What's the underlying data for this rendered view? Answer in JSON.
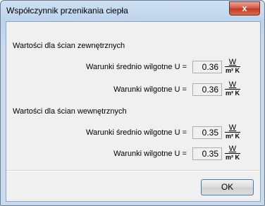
{
  "window": {
    "title": "Współczynnik przenikania ciepła",
    "close_glyph": "x"
  },
  "groups": [
    {
      "header": "Wartości dla ścian zewnętrznych",
      "rows": [
        {
          "label": "Warunki średnio wilgotne U =",
          "value": "0.36",
          "unit_num": "W",
          "unit_den": "m² K"
        },
        {
          "label": "Warunki wilgotne U =",
          "value": "0.36",
          "unit_num": "W",
          "unit_den": "m² K"
        }
      ]
    },
    {
      "header": "Wartości dla ścian wewnętrznych",
      "rows": [
        {
          "label": "Warunki średnio wilgotne U =",
          "value": "0.35",
          "unit_num": "W",
          "unit_den": "m² K"
        },
        {
          "label": "Warunki wilgotne U =",
          "value": "0.35",
          "unit_num": "W",
          "unit_den": "m² K"
        }
      ]
    }
  ],
  "buttons": {
    "ok_label": "OK"
  }
}
